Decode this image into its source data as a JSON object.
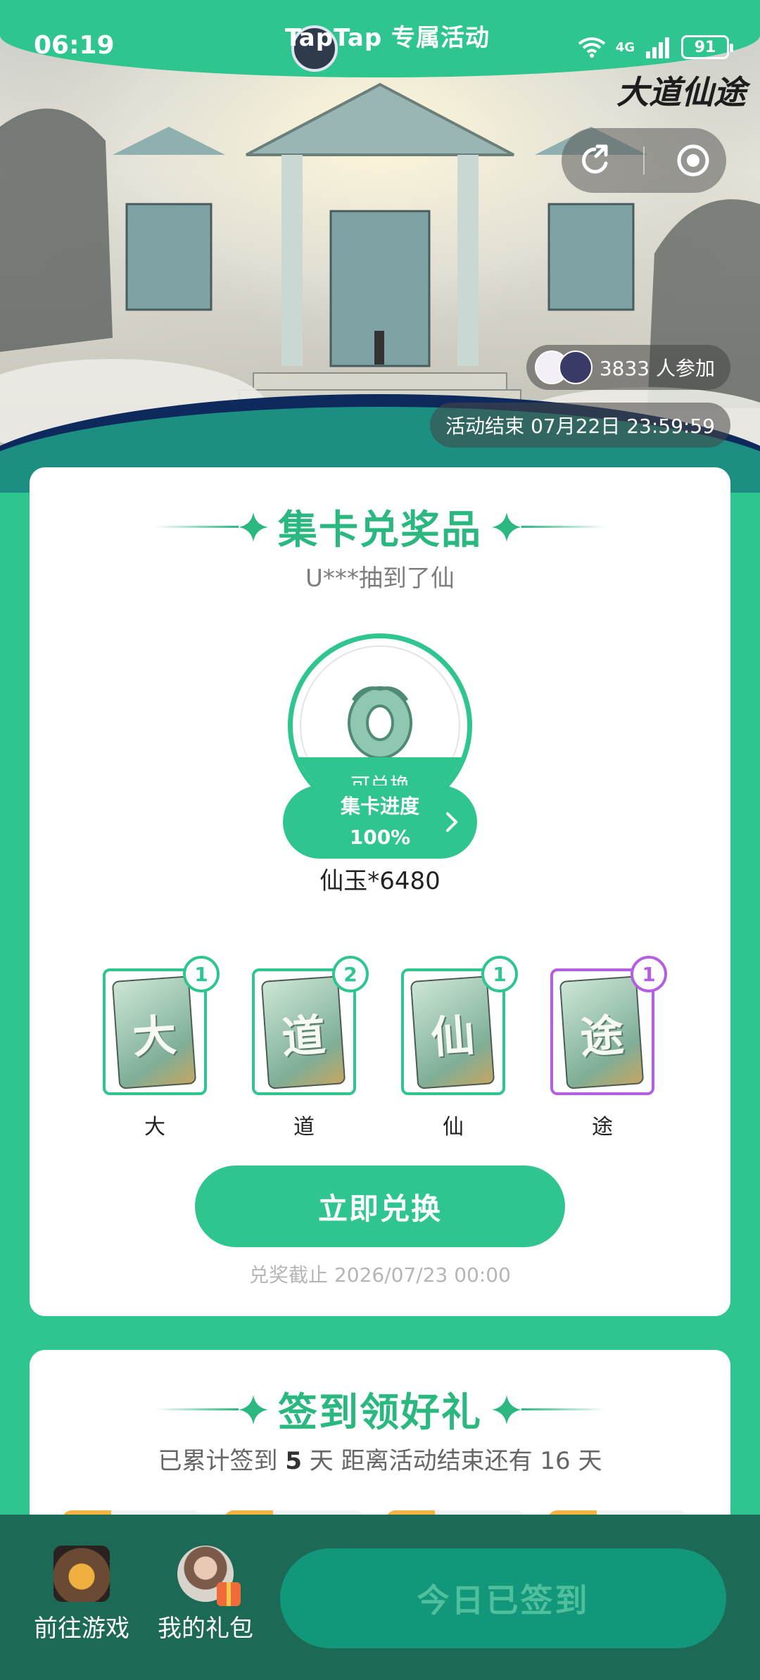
{
  "status_bar": {
    "time": "06:19",
    "network": "4G",
    "battery": "91"
  },
  "header": {
    "title": "TapTap 专属活动"
  },
  "banner": {
    "game_logo": "大道仙途",
    "participants": "3833 人参加",
    "end_time": "活动结束 07月22日 23:59:59",
    "icons": [
      "share-icon",
      "record-icon"
    ]
  },
  "collect": {
    "title": "集卡兑奖品",
    "ticker": "U***抽到了仙",
    "prize_status": "可兑换",
    "progress_label": "集卡进度",
    "progress_value": "100%",
    "progress": 1.0,
    "prize_name": "仙玉*6480",
    "cards": [
      {
        "char": "大",
        "label": "大",
        "count": "1"
      },
      {
        "char": "道",
        "label": "道",
        "count": "2"
      },
      {
        "char": "仙",
        "label": "仙",
        "count": "1"
      },
      {
        "char": "途",
        "label": "途",
        "count": "1"
      }
    ],
    "redeem_label": "立即兑换",
    "deadline": "兑奖截止 2026/07/23 00:00"
  },
  "checkin": {
    "title": "签到领好礼",
    "summary_prefix": "已累计签到",
    "days": "5",
    "summary_mid": "天  距离活动结束还有 16 天"
  },
  "bottom_bar": {
    "go_game": "前往游戏",
    "my_gifts": "我的礼包",
    "checked_in": "今日已签到"
  },
  "colors": {
    "accent": "#2fc58f",
    "purple": "#b45ee0",
    "bottom_bar": "#1c6a55"
  }
}
